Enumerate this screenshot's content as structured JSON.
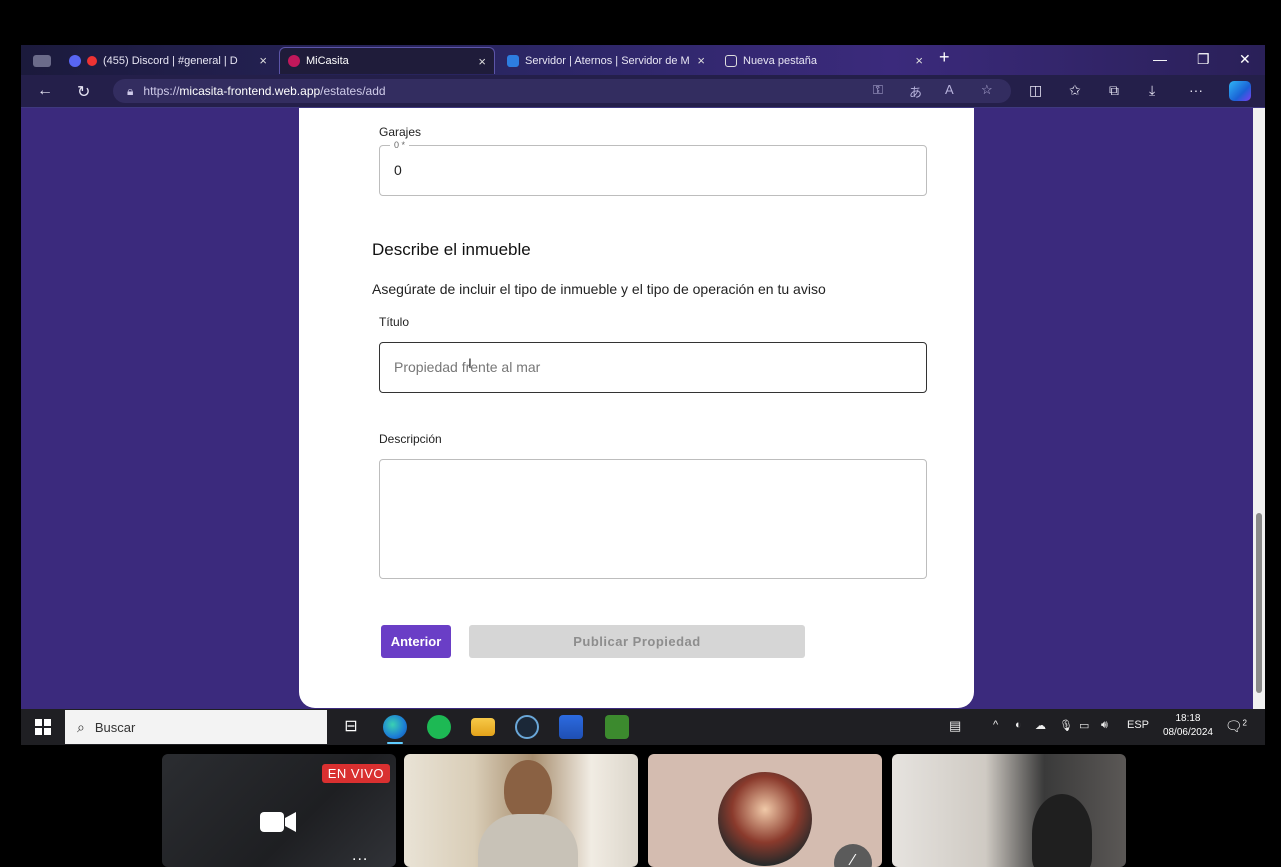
{
  "browser": {
    "tabs": [
      {
        "label": "(455) Discord | #general | D",
        "badge": "455"
      },
      {
        "label": "MiCasita"
      },
      {
        "label": "Servidor | Aternos | Servidor de M"
      },
      {
        "label": "Nueva pestaña"
      }
    ],
    "url_prefix": "https://",
    "url_host": "micasita-frontend.web.app",
    "url_path": "/estates/add"
  },
  "form": {
    "garajes": {
      "label": "Garajes",
      "legend": "0 *",
      "value": "0"
    },
    "section_title": "Describe el inmueble",
    "section_subtitle": "Asegúrate de incluir el tipo de inmueble y el tipo de operación en tu aviso",
    "titulo": {
      "label": "Título",
      "placeholder": "Propiedad frente al mar"
    },
    "descripcion": {
      "label": "Descripción",
      "value": ""
    },
    "prev_button": "Anterior",
    "publish_button": "Publicar Propiedad"
  },
  "taskbar": {
    "search_placeholder": "Buscar",
    "language": "ESP",
    "time": "18:18",
    "date": "08/06/2024",
    "notification_count": "2"
  },
  "video_strip": {
    "live_label": "EN VIVO",
    "more_label": "..."
  },
  "colors": {
    "page_bg": "#3b2a7d",
    "primary": "#6a3ec6",
    "disabled": "#d6d6d6"
  }
}
